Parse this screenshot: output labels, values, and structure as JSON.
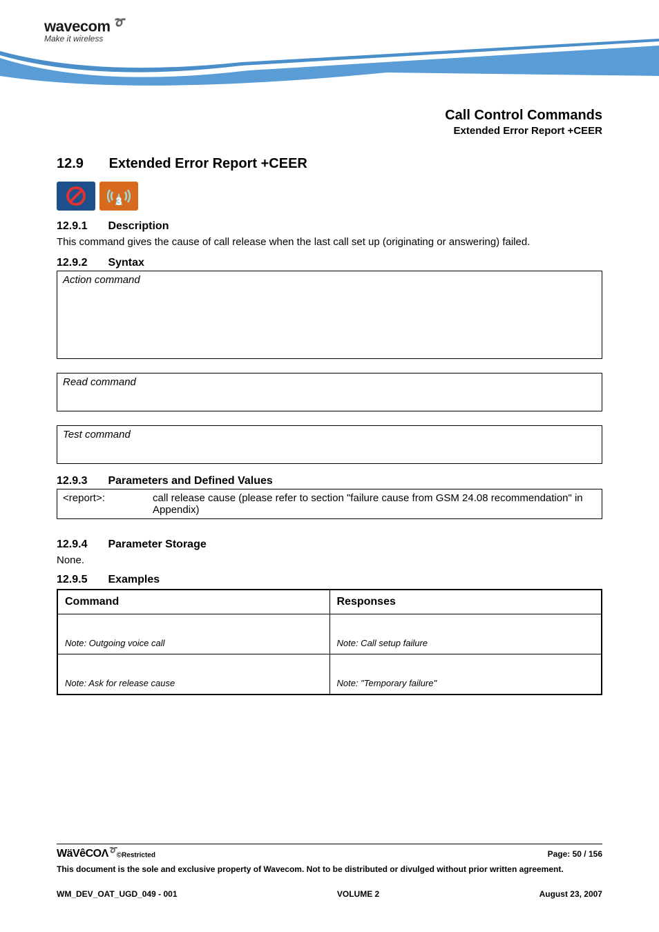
{
  "brand": {
    "name": "wavecom",
    "tagline": "Make it wireless"
  },
  "header": {
    "chapter_title": "Call Control Commands",
    "chapter_subtitle": "Extended Error Report +CEER"
  },
  "section": {
    "num": "12.9",
    "title": "Extended Error Report +CEER"
  },
  "sub": {
    "desc_num": "12.9.1",
    "desc_title": "Description",
    "desc_body": "This command gives the cause of call release when the last call set up (originating or answering) failed.",
    "syntax_num": "12.9.2",
    "syntax_title": "Syntax",
    "action_label": "Action command",
    "read_label": "Read command",
    "test_label": "Test command",
    "params_num": "12.9.3",
    "params_title": "Parameters and Defined Values",
    "param_name": "<report>:",
    "param_desc": "call release cause (please refer to section \"failure cause from GSM 24.08 recommendation\" in Appendix)",
    "storage_num": "12.9.4",
    "storage_title": "Parameter Storage",
    "storage_body": "None.",
    "examples_num": "12.9.5",
    "examples_title": "Examples"
  },
  "examples_table": {
    "head_command": "Command",
    "head_responses": "Responses",
    "rows": [
      {
        "cmd": "Note: Outgoing voice call",
        "resp": "Note: Call setup failure"
      },
      {
        "cmd": "Note: Ask for release cause",
        "resp": "Note: \"Temporary failure\""
      }
    ]
  },
  "footer": {
    "restricted": "©Restricted",
    "page_label": "Page: ",
    "page_current": "50",
    "page_sep": " / ",
    "page_total": "156",
    "disclaimer": "This document is the sole and exclusive property of Wavecom. Not to be distributed or divulged without prior written agreement.",
    "doc_id": "WM_DEV_OAT_UGD_049 - 001",
    "volume": "VOLUME 2",
    "date": "August 23, 2007"
  }
}
